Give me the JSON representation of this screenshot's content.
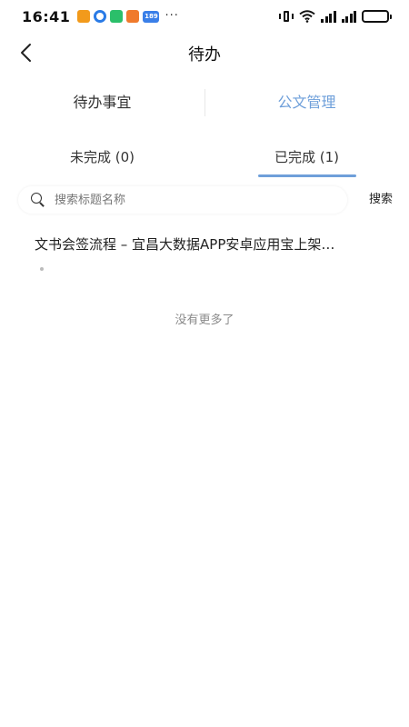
{
  "status_bar": {
    "time": "16:41",
    "badge_189": "189",
    "more": "···"
  },
  "nav": {
    "title": "待办"
  },
  "top_tabs": [
    {
      "label": "待办事宜"
    },
    {
      "label": "公文管理"
    }
  ],
  "sub_tabs": [
    {
      "label": "未完成 (0)"
    },
    {
      "label": "已完成 (1)"
    }
  ],
  "search": {
    "placeholder": "搜索标题名称",
    "value": "",
    "button_label": "搜索"
  },
  "list": {
    "items": [
      {
        "title": "文书会签流程 – 宜昌大数据APP安卓应用宝上架…"
      }
    ]
  },
  "footer": {
    "no_more": "没有更多了"
  },
  "colors": {
    "accent": "#6e9fda",
    "text": "#222222",
    "muted": "#8a8a8a"
  }
}
